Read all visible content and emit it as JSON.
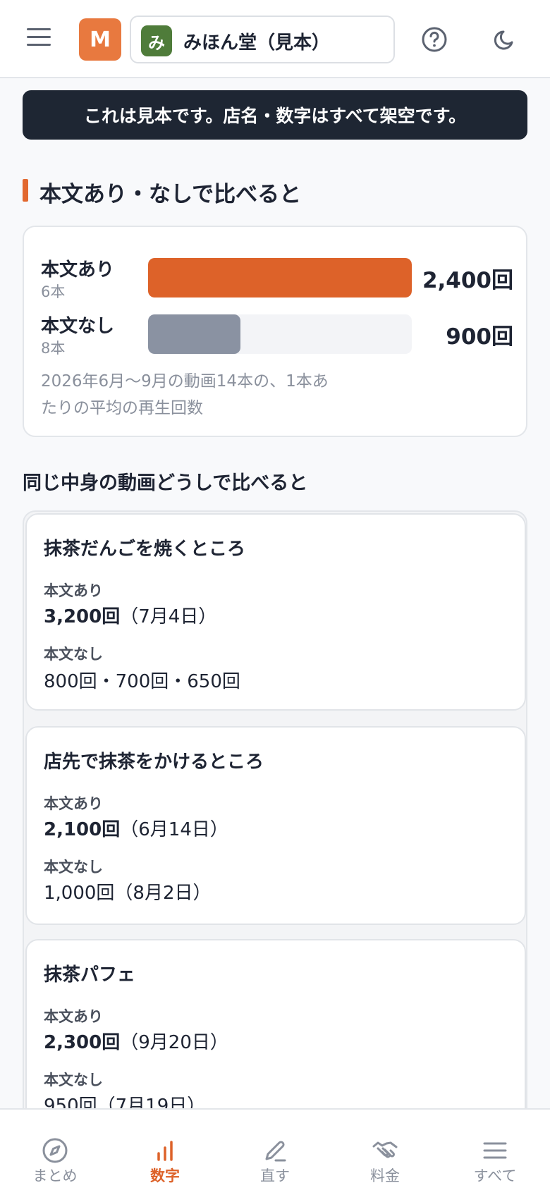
{
  "header": {
    "brand_initial": "M",
    "store_initial": "み",
    "store_name": "みほん堂（見本）",
    "menu_icon": "hamburger-menu-icon",
    "help_icon": "question-circle-icon",
    "theme_icon": "moon-icon"
  },
  "notice": "これは見本です。店名・数字はすべて架空です。",
  "section_title": "本文あり・なしで比べると",
  "comparison": {
    "rows": [
      {
        "label": "本文あり",
        "count": "6本",
        "value": "2,400回",
        "fill_fraction": 1.0,
        "color": "#dd6229"
      },
      {
        "label": "本文なし",
        "count": "8本",
        "value": "900回",
        "fill_fraction": 0.35,
        "color": "#8a92a2"
      }
    ],
    "note": "2026年6月〜9月の動画14本の、1本あたりの平均の再生回数"
  },
  "sub_title": "同じ中身の動画どうしで比べると",
  "videos": [
    {
      "title": "抹茶だんごを焼くところ",
      "with_label": "本文あり",
      "with_views": "3,200回",
      "with_date": "（7月4日）",
      "without_label": "本文なし",
      "without_views": "800回・700回・650回"
    },
    {
      "title": "店先で抹茶をかけるところ",
      "with_label": "本文あり",
      "with_views": "2,100回",
      "with_date": "（6月14日）",
      "without_label": "本文なし",
      "without_views": "1,000回（8月2日）"
    },
    {
      "title": "抹茶パフェ",
      "with_label": "本文あり",
      "with_views": "2,300回",
      "with_date": "（9月20日）",
      "without_label": "本文なし",
      "without_views": "950回（7月19日）"
    }
  ],
  "nav": [
    {
      "label": "まとめ",
      "icon": "compass-icon",
      "active": false
    },
    {
      "label": "数字",
      "icon": "bar-chart-icon",
      "active": true
    },
    {
      "label": "直す",
      "icon": "pencil-icon",
      "active": false
    },
    {
      "label": "料金",
      "icon": "handshake-icon",
      "active": false
    },
    {
      "label": "すべて",
      "icon": "menu-icon",
      "active": false
    }
  ],
  "colors": {
    "accent": "#dd6229",
    "brand_badge": "#e8793f",
    "store_badge": "#4f7c3a",
    "notice_bg": "#1e2633"
  }
}
